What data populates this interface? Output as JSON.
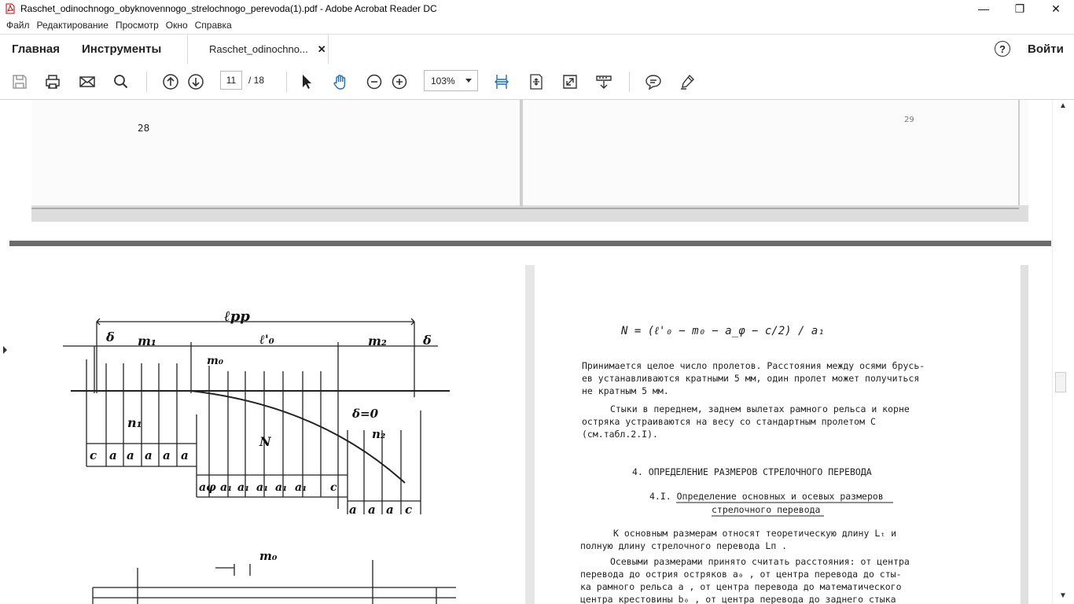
{
  "window": {
    "title": "Raschet_odinochnogo_obyknovennogo_strelochnogo_perevoda(1).pdf - Adobe Acrobat Reader DC",
    "minimize": "—",
    "maximize": "❐",
    "close": "✕"
  },
  "menu": [
    "Файл",
    "Редактирование",
    "Просмотр",
    "Окно",
    "Справка"
  ],
  "tabs": {
    "home": "Главная",
    "tools": "Инструменты",
    "document": "Raschet_odinochno...",
    "close": "✕",
    "help": "?",
    "signin": "Войти"
  },
  "toolbar": {
    "page_current": "11",
    "page_total": "/ 18",
    "zoom": "103%"
  },
  "document": {
    "top_page_number_left": "28",
    "top_page_number_right": "29",
    "formula": "N = (ℓ'₀ − m₀ − a_φ − c/2) / a₁",
    "paragraph1": [
      "Принимается целое число пролетов. Расстояния между осями брусь-",
      "ев устанавливаются кратными 5 мм, один пролет может получиться",
      "не кратным 5 мм."
    ],
    "paragraph2": [
      "Стыки в переднем, заднем вылетах рамного рельса и корне",
      "остряка устраиваются на весу со стандартным пролетом  C",
      "(см.табл.2.I)."
    ],
    "heading": "4. ОПРЕДЕЛЕНИЕ РАЗМЕРОВ СТРЕЛОЧНОГО ПЕРЕВОДА",
    "subheading1": "4.I. Определение основных и осевых размеров",
    "subheading2": "стрелочного перевода",
    "paragraph3": [
      "К основным размерам относят теоретическую длину   Lₜ  и",
      "полную длину стрелочного перевода   Lп  ."
    ],
    "paragraph4": [
      "Осевыми размерами принято считать расстояния: от центра",
      "перевода до острия остряков   a₀  , от центра перевода до сты-",
      "ка рамного рельса   a  , от центра перевода до математического",
      "центра крестовины   b₀  , от центра перевода до заднего стыка"
    ],
    "diagram": {
      "top_label": "ℓрр",
      "delta_left": "δ",
      "delta_right": "δ",
      "m1": "m₁",
      "l0": "ℓ'₀",
      "m2": "m₂",
      "m0": "m₀",
      "m0_lower": "m₀",
      "n1": "n₁",
      "N": "N",
      "delta0": "δ=0",
      "n2": "n₂",
      "row1": [
        "c",
        "a",
        "a",
        "a",
        "a",
        "a"
      ],
      "row2": [
        "aφ",
        "a₁",
        "a₁",
        "a₁",
        "a₁",
        "a₁",
        "c"
      ],
      "row3": [
        "a",
        "a",
        "a",
        "c"
      ]
    }
  }
}
